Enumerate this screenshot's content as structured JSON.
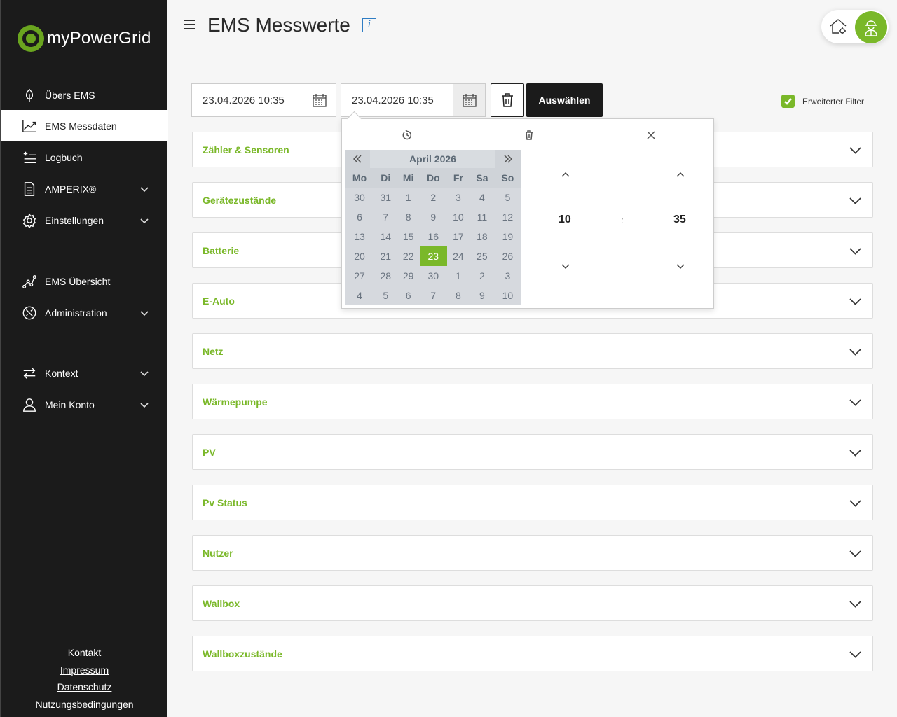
{
  "brand": {
    "name": "myPowerGrid"
  },
  "sidebar": {
    "items": [
      {
        "label": "Übers EMS",
        "icon": "leaf-icon"
      },
      {
        "label": "EMS Messdaten",
        "icon": "chart-line-icon"
      },
      {
        "label": "Logbuch",
        "icon": "list-add-icon"
      },
      {
        "label": "AMPERIX®",
        "icon": "document-icon"
      },
      {
        "label": "Einstellungen",
        "icon": "gear-icon"
      },
      {
        "label": "EMS Übersicht",
        "icon": "graph-nodes-icon"
      },
      {
        "label": "Administration",
        "icon": "settings-circle-icon"
      },
      {
        "label": "Kontext",
        "icon": "swap-arrows-icon"
      },
      {
        "label": "Mein Konto",
        "icon": "user-icon"
      }
    ],
    "active": "EMS Messdaten",
    "footer": [
      "Kontakt",
      "Impressum",
      "Datenschutz",
      "Nutzungsbedingungen"
    ]
  },
  "header": {
    "title": "EMS Messwerte",
    "info": "i"
  },
  "filter": {
    "from": "23.04.2026 10:35",
    "to": "23.04.2026 10:35",
    "select_label": "Auswählen",
    "extended_filter_label": "Erweiterter Filter",
    "extended_filter_checked": true
  },
  "sections": [
    "Zähler & Sensoren",
    "Gerätezustände",
    "Batterie",
    "E-Auto",
    "Netz",
    "Wärmepumpe",
    "PV",
    "Pv Status",
    "Nutzer",
    "Wallbox",
    "Wallboxzustände"
  ],
  "picker": {
    "month": "April 2026",
    "weekdays": [
      "Mo",
      "Di",
      "Mi",
      "Do",
      "Fr",
      "Sa",
      "So"
    ],
    "weeks": [
      [
        "30",
        "31",
        "1",
        "2",
        "3",
        "4",
        "5"
      ],
      [
        "6",
        "7",
        "8",
        "9",
        "10",
        "11",
        "12"
      ],
      [
        "13",
        "14",
        "15",
        "16",
        "17",
        "18",
        "19"
      ],
      [
        "20",
        "21",
        "22",
        "23",
        "24",
        "25",
        "26"
      ],
      [
        "27",
        "28",
        "29",
        "30",
        "1",
        "2",
        "3"
      ],
      [
        "4",
        "5",
        "6",
        "7",
        "8",
        "9",
        "10"
      ]
    ],
    "selected_day": "23",
    "hour": "10",
    "minute": "35",
    "separator": ":"
  },
  "colors": {
    "accent": "#7ab829",
    "sidebar_bg": "#1b1b1b",
    "info": "#2f7dc4"
  }
}
